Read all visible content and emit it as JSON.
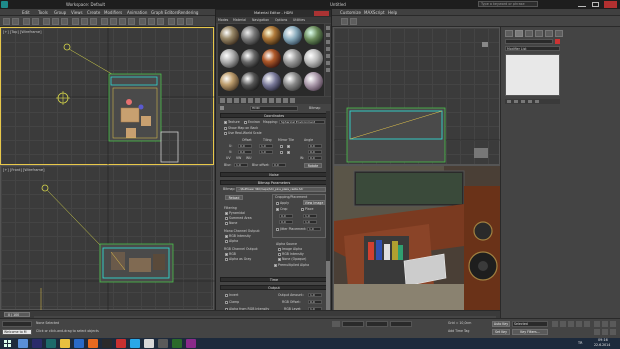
{
  "window": {
    "app_title": "Workspace: Default",
    "file_title": "Untitled",
    "search_placeholder": "Type a keyword or phrase"
  },
  "menus": [
    "Edit",
    "Tools",
    "Group",
    "Views",
    "Create",
    "Modifiers",
    "Animation",
    "Graph Editors",
    "Rendering",
    "Customize",
    "MAXScript",
    "Help"
  ],
  "viewports": {
    "top_left_label": "[+] [Top] [Wireframe]",
    "front_left_label": "[+] [Front] [Wireframe]"
  },
  "material_editor": {
    "title": "Material Editor - HDRI",
    "menu": [
      "Modes",
      "Material",
      "Navigation",
      "Options",
      "Utilities"
    ],
    "material_name": "HDRI",
    "material_type": "Bitmap",
    "coordinates_header": "Coordinates",
    "texture_label": "Texture",
    "environ_label": "Environ",
    "mapping_label": "Mapping:",
    "mapping_value": "Spherical Environment",
    "show_map_label": "Show Map on Back",
    "use_real_world_label": "Use Real-World Scale",
    "offset_label": "Offset",
    "tiling_label": "Tiling",
    "mirror_tile_label": "Mirror Tile",
    "angle_label": "Angle",
    "u_label": "U:",
    "v_label": "V:",
    "w_label": "W:",
    "u_offset": "0,0",
    "v_offset": "0,0",
    "u_tiling": "1,0",
    "v_tiling": "1,0",
    "u_angle": "0,0",
    "v_angle": "0,0",
    "w_angle": "0,0",
    "uv_label": "UV",
    "vw_label": "VW",
    "wu_label": "WU",
    "blur_label": "Blur:",
    "blur_value": "1,0",
    "blur_offset_label": "Blur offset:",
    "blur_offset_value": "0,0",
    "rotate_label": "Rotate",
    "noise_header": "Noise",
    "bitmap_params_header": "Bitmap Parameters",
    "bitmap_label": "Bitmap:",
    "bitmap_path": "...\\Bellflower 360\\maps\\hdri_pine_plaza_castle.hdr",
    "reload_label": "Reload",
    "cropping_label": "Cropping/Placement",
    "apply_label": "Apply",
    "view_image_label": "View Image",
    "crop_label": "Crop",
    "place_label": "Place",
    "u_crop": "0,0",
    "w_crop": "1,0",
    "v_crop": "0,0",
    "h_crop": "1,0",
    "jitter_label": "Jitter Placement:",
    "jitter_value": "1,0",
    "filtering_label": "Filtering",
    "pyramidal_label": "Pyramidal",
    "summed_label": "Summed Area",
    "none_label": "None",
    "mono_output_label": "Mono Channel Output:",
    "rgb_intensity_label": "RGB Intensity",
    "alpha_label": "Alpha",
    "rgb_channel_output_label": "RGB Channel Output:",
    "rgb_label": "RGB",
    "alpha_as_gray_label": "Alpha as Gray",
    "alpha_source_label": "Alpha Source",
    "image_alpha_label": "Image Alpha",
    "rgb_intensity2_label": "RGB Intensity",
    "none_opaque_label": "None (Opaque)",
    "premult_label": "Premultiplied Alpha",
    "time_header": "Time",
    "output_header": "Output",
    "invert_label": "Invert",
    "clamp_label": "Clamp",
    "alpha_from_rgb_label": "Alpha from RGB Intensity",
    "enable_color_map_label": "Enable Color Map",
    "output_amount_label": "Output Amount:",
    "output_amount": "1,0",
    "rgb_offset_label": "RGB Offset:",
    "rgb_offset": "0,0",
    "rgb_level_label": "RGB Level:",
    "rgb_level": "1,0",
    "bump_amount_label": "Bump Amount:",
    "bump_amount": "1,0",
    "color_map_label": "Color Map:"
  },
  "command_panel": {
    "modifier_list_label": "Modifier List"
  },
  "timeline": {
    "frame_label": "0 / 100"
  },
  "status": {
    "selection_text": "None Selected",
    "prompt_text": "Click or click-and-drag to select objects",
    "welcome_text": "Welcome to M",
    "grid_text": "Grid = 10,0cm",
    "add_time_tag": "Add Time Tag",
    "autokey_label": "Auto Key",
    "selected_label": "Selected",
    "setkey_label": "Set Key",
    "key_filters_label": "Key Filters..."
  },
  "taskbar": {
    "time": "09:16",
    "date": "22.6.2014",
    "lang": "TR"
  },
  "colors": {
    "accent_yellow": "#e8c84a",
    "selection_cyan": "#2fd6d0",
    "scene_green": "#49c24a"
  }
}
